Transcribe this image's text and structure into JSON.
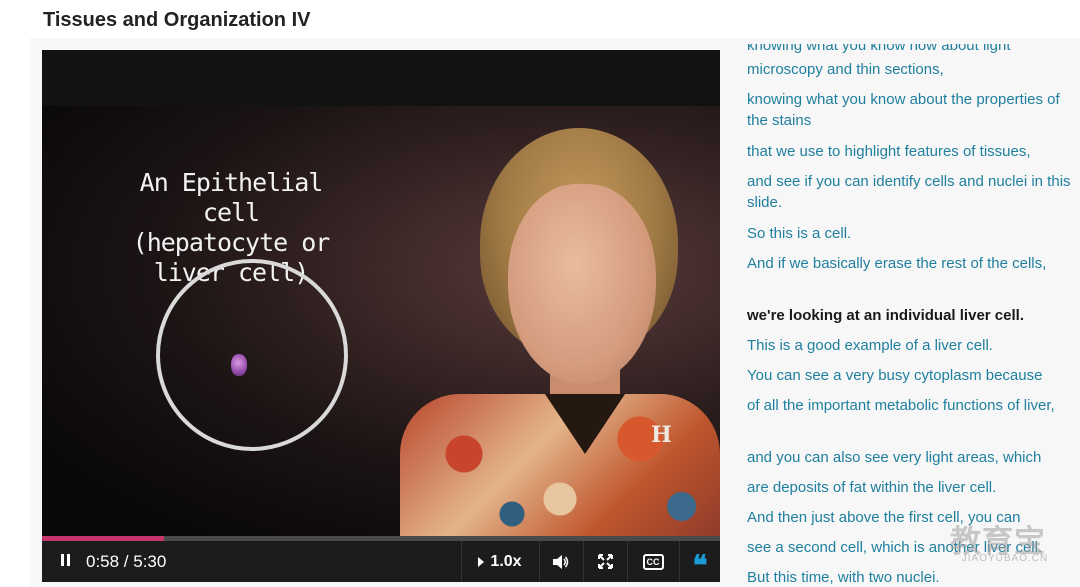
{
  "page": {
    "title": "Tissues and Organization IV"
  },
  "video": {
    "overlay_title_line1": "An Epithelial cell",
    "overlay_title_line2": "(hepatocyte or liver cell)",
    "logo_letter": "H",
    "progress_fraction": 0.18,
    "controls": {
      "time": "0:58 / 5:30",
      "speed": "1.0x",
      "pause_icon": "pause-icon",
      "volume_icon": "volume-icon",
      "fullscreen_icon": "fullscreen-icon",
      "cc_label": "CC",
      "transcript_toggle_icon": "quote-icon"
    },
    "colors": {
      "progress": "#c7356d",
      "transcript_toggle": "#1a9ad6"
    }
  },
  "transcript": {
    "link_color": "#1f7f9f",
    "lines": [
      "knowing what you know now about light",
      "microscopy and thin sections,",
      "knowing what you know about the properties of the stains",
      "that we use to highlight features of tissues,",
      "and see if you can identify cells and nuclei in this slide.",
      "So this is a cell.",
      "And if we basically erase the rest of the cells,",
      "we're looking at an individual liver cell.",
      "This is a good example of a liver cell.",
      "You can see a very busy cytoplasm because",
      "of all the important metabolic functions of liver,",
      "and you can also see very light areas, which",
      "are deposits of fat within the liver cell.",
      "And then just above the first cell, you can",
      "see a second cell, which is another liver cell.",
      "But this time, with two nuclei."
    ],
    "current_index": 7
  },
  "watermark": {
    "logo_text": "教育宝",
    "url_text": "JIAOYUBAO.CN"
  }
}
